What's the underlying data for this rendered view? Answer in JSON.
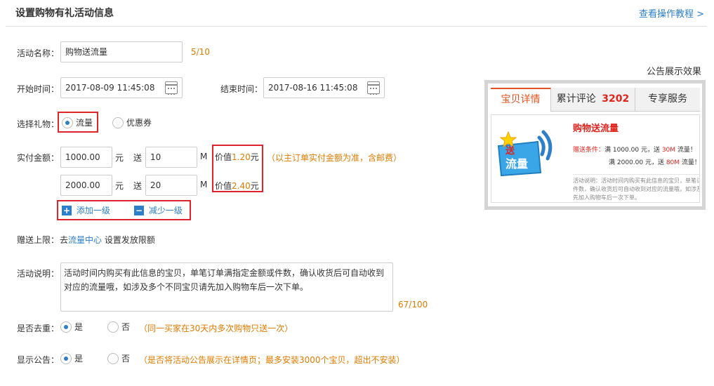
{
  "header": {
    "title": "设置购物有礼活动信息",
    "tutorial_link": "查看操作教程 >"
  },
  "form": {
    "name_label": "活动名称：",
    "name_value": "购物送流量",
    "name_counter": "5/10",
    "start_label": "开始时间：",
    "start_value": "2017-08-09 11:45:08",
    "end_label": "结束时间：",
    "end_value": "2017-08-16 11:45:08",
    "gift_label": "选择礼物：",
    "gift_options": [
      "流量",
      "优惠券"
    ],
    "gift_selected": "流量",
    "amount_label": "实付金额：",
    "tiers": [
      {
        "amount": "1000.00",
        "yuan": "元",
        "give": "送",
        "mb": "10",
        "unit": "M",
        "value_prefix": "价值",
        "value": "1.20",
        "value_suffix": "元"
      },
      {
        "amount": "2000.00",
        "yuan": "元",
        "give": "送",
        "mb": "20",
        "unit": "M",
        "value_prefix": "价值",
        "value": "2.40",
        "value_suffix": "元"
      }
    ],
    "amount_note": "（以主订单实付金额为准，含邮费）",
    "add_level": "添加一级",
    "remove_level": "减少一级",
    "limit_label": "赠送上限：",
    "limit_text_pre": "去",
    "limit_link": "流量中心",
    "limit_text_post": " 设置发放限额",
    "desc_label": "活动说明：",
    "desc_value": "活动时间内购买有此信息的宝贝，单笔订单满指定金额或件数，确认收货后可自动收到对应的流量哦，如涉及多个不同宝贝请先加入购物车后一次下单。",
    "desc_counter": "67/100",
    "dedup_label": "是否去重：",
    "dedup_yes": "是",
    "dedup_no": "否",
    "dedup_note": "（同一买家在30天内多次购物只送一次）",
    "notice_label": "显示公告：",
    "notice_yes": "是",
    "notice_no": "否",
    "notice_note": "（是否将活动公告展示在详情页；最多安装3000个宝贝，超出不安装）"
  },
  "preview": {
    "title": "公告展示效果",
    "tabs": [
      "宝贝详情",
      "累计评论",
      "3202",
      "专享服务"
    ],
    "badge_top": "送",
    "badge_main": "流量",
    "promo_title": "购物送流量",
    "cond_label": "赠送条件：",
    "line1_pre": "满 1000.00 元，送 ",
    "line1_hl": "30M",
    "line1_post": " 流量！",
    "line2_pre": "满 2000.00 元，送 ",
    "line2_hl": "80M",
    "line2_post": " 流量！",
    "desc_small": "活动说明：活动时间内购买有此信息的宝贝，单笔订单满指定金额或件数，确认收货后可自动收到对应的流量哦，如涉及多个不同宝贝请先加入购物车后一次下单。"
  },
  "colors": {
    "accent": "#2d7fc9",
    "warning": "#e07b00",
    "highlight_box": "#e0242c",
    "preview_red": "#e0241c"
  }
}
